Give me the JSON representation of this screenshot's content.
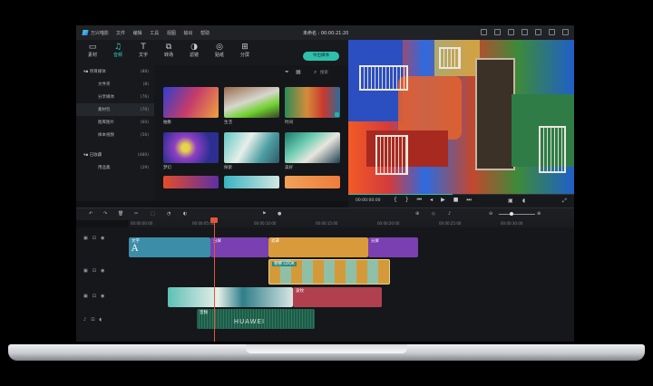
{
  "titlebar": {
    "app_name": "万兴喵影",
    "menus": [
      "文件",
      "编辑",
      "工具",
      "视图",
      "输出",
      "帮助"
    ],
    "project": "未命名 : 00:00:21:20"
  },
  "toolbar": {
    "items": [
      {
        "label": "素材",
        "icon": "media-icon"
      },
      {
        "label": "音频",
        "icon": "music-icon"
      },
      {
        "label": "文字",
        "icon": "text-icon"
      },
      {
        "label": "转场",
        "icon": "transition-icon"
      },
      {
        "label": "滤镜",
        "icon": "filter-icon"
      },
      {
        "label": "贴纸",
        "icon": "sticker-icon"
      },
      {
        "label": "分屏",
        "icon": "split-screen-icon"
      }
    ]
  },
  "sidebar": {
    "items": [
      {
        "label": "项目媒体",
        "count": "(88)"
      },
      {
        "label": "文件夹",
        "count": "(8)"
      },
      {
        "label": "分享媒体",
        "count": "(76)"
      },
      {
        "label": "素材包",
        "count": "(76)"
      },
      {
        "label": "图库图片",
        "count": "(60)"
      },
      {
        "label": "样本视频",
        "count": "(56)"
      },
      {
        "label": "已收藏",
        "count": "(480)"
      },
      {
        "label": "用品集",
        "count": "(29)"
      }
    ]
  },
  "media": {
    "import_label": "导出媒体",
    "search_placeholder": "搜索",
    "thumbs": [
      "抽象",
      "生活",
      "时间",
      "梦幻",
      "探索",
      "美好"
    ]
  },
  "preview": {
    "timecode": "00:00:00:00"
  },
  "timeline": {
    "ruler": [
      "00:00:00:00",
      "00:00:05:00",
      "00:00:10:00",
      "00:00:15:00",
      "00:00:20:00",
      "00:00:25:00",
      "00:00:30:00"
    ],
    "clips": {
      "text_clip": "文字",
      "split_clip_1": "分屏",
      "mask_clip": "遮罩",
      "split_clip_2": "分屏",
      "lut_clip": "替换 LOOK",
      "transition_clip": "波纹",
      "music_clip": "音频"
    }
  },
  "brand": "HUAWEI",
  "colors": {
    "accent": "#2fc0ad",
    "playhead": "#e3563c",
    "text_clip": "#3c8da8",
    "split_clip": "#7a3fb0",
    "mask_clip": "#d89a3b",
    "lut_clip": "#2d8a82",
    "transition_clip": "#b1404e",
    "music_clip": "#1f5a48"
  }
}
